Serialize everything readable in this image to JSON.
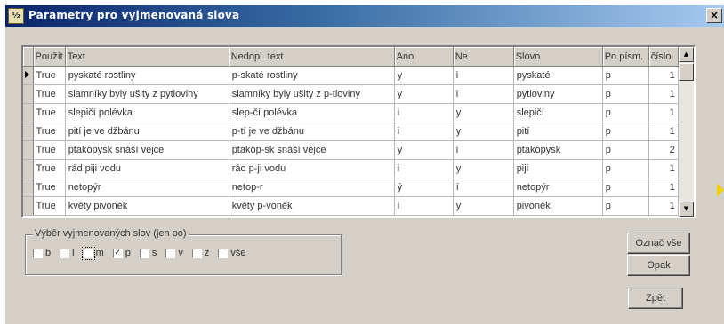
{
  "window": {
    "title": "Parametry pro vyjmenovaná slova",
    "icon_label": "⅟₂",
    "close_label": "×"
  },
  "grid": {
    "columns": [
      "Použít",
      "Text",
      "Nedopl. text",
      "Ano",
      "Ne",
      "Slovo",
      "Po písm.",
      "číslo"
    ],
    "rows": [
      [
        "True",
        "pyskaté rostliny",
        "p-skaté rostliny",
        "y",
        "i",
        "pyskaté",
        "p",
        "1"
      ],
      [
        "True",
        "slamníky byly ušity z pytloviny",
        "slamníky byly ušity z p-tloviny",
        "y",
        "i",
        "pytloviny",
        "p",
        "1"
      ],
      [
        "True",
        "slepičí polévka",
        "slep-čí polévka",
        "i",
        "y",
        "slepičí",
        "p",
        "1"
      ],
      [
        "True",
        "pití je ve džbánu",
        "p-tí je ve džbánu",
        "i",
        "y",
        "pití",
        "p",
        "1"
      ],
      [
        "True",
        "ptakopysk snáší vejce",
        "ptakop-sk snáší vejce",
        "y",
        "i",
        "ptakopysk",
        "p",
        "2"
      ],
      [
        "True",
        "rád piji vodu",
        "rád p-ji vodu",
        "i",
        "y",
        "piji",
        "p",
        "1"
      ],
      [
        "True",
        "netopýr",
        "netop-r",
        "ý",
        "í",
        "netopýr",
        "p",
        "1"
      ],
      [
        "True",
        "květy pivoněk",
        "květy p-voněk",
        "i",
        "y",
        "pivoněk",
        "p",
        "1"
      ]
    ],
    "selected_row": 0,
    "scroll_up": "▲",
    "scroll_down": "▼"
  },
  "filter": {
    "label": "Výběr vyjmenovaných slov (jen po)",
    "options": [
      {
        "label": "b",
        "checked": false
      },
      {
        "label": "l",
        "checked": false
      },
      {
        "label": "m",
        "checked": false,
        "focused": true
      },
      {
        "label": "p",
        "checked": true
      },
      {
        "label": "s",
        "checked": false
      },
      {
        "label": "v",
        "checked": false
      },
      {
        "label": "z",
        "checked": false
      },
      {
        "label": "vše",
        "checked": false
      }
    ]
  },
  "buttons": {
    "mark_all": "Označ vše",
    "swap": "Opak",
    "back": "Zpět"
  }
}
